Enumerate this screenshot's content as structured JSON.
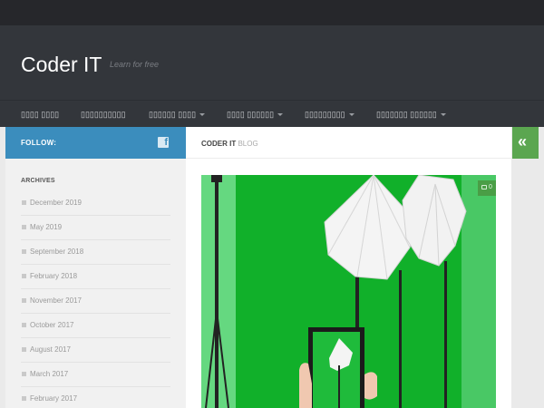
{
  "header": {
    "site_title": "Coder IT",
    "tagline": "Learn for free"
  },
  "nav": {
    "items": [
      {
        "label": "▯▯▯▯ ▯▯▯▯",
        "has_dropdown": false
      },
      {
        "label": "▯▯▯▯▯▯▯▯▯▯",
        "has_dropdown": false
      },
      {
        "label": "▯▯▯▯▯▯ ▯▯▯▯",
        "has_dropdown": true
      },
      {
        "label": "▯▯▯▯ ▯▯▯▯▯▯",
        "has_dropdown": true
      },
      {
        "label": "▯▯▯▯▯▯▯▯▯",
        "has_dropdown": true
      },
      {
        "label": "▯▯▯▯▯▯▯ ▯▯▯▯▯▯",
        "has_dropdown": true
      }
    ]
  },
  "sidebar": {
    "follow_label": "FOLLOW:",
    "follow_icon": "facebook-icon",
    "archives_title": "ARCHIVES",
    "archives": [
      "December 2019",
      "May 2019",
      "September 2018",
      "February 2018",
      "November 2017",
      "October 2017",
      "August 2017",
      "March 2017",
      "February 2017"
    ]
  },
  "content": {
    "blog_title_strong": "CODER IT",
    "blog_title_light": "BLOG",
    "comment_count": "0",
    "comment_icon": "comment-bubble-icon"
  },
  "collapse_icon": "double-chevron-left-icon",
  "colors": {
    "accent_blue": "#3b8dbd",
    "accent_green": "#5ba650",
    "header_bg": "#33363b",
    "topbar_bg": "#26272b",
    "photo_green": "#11b02a"
  }
}
